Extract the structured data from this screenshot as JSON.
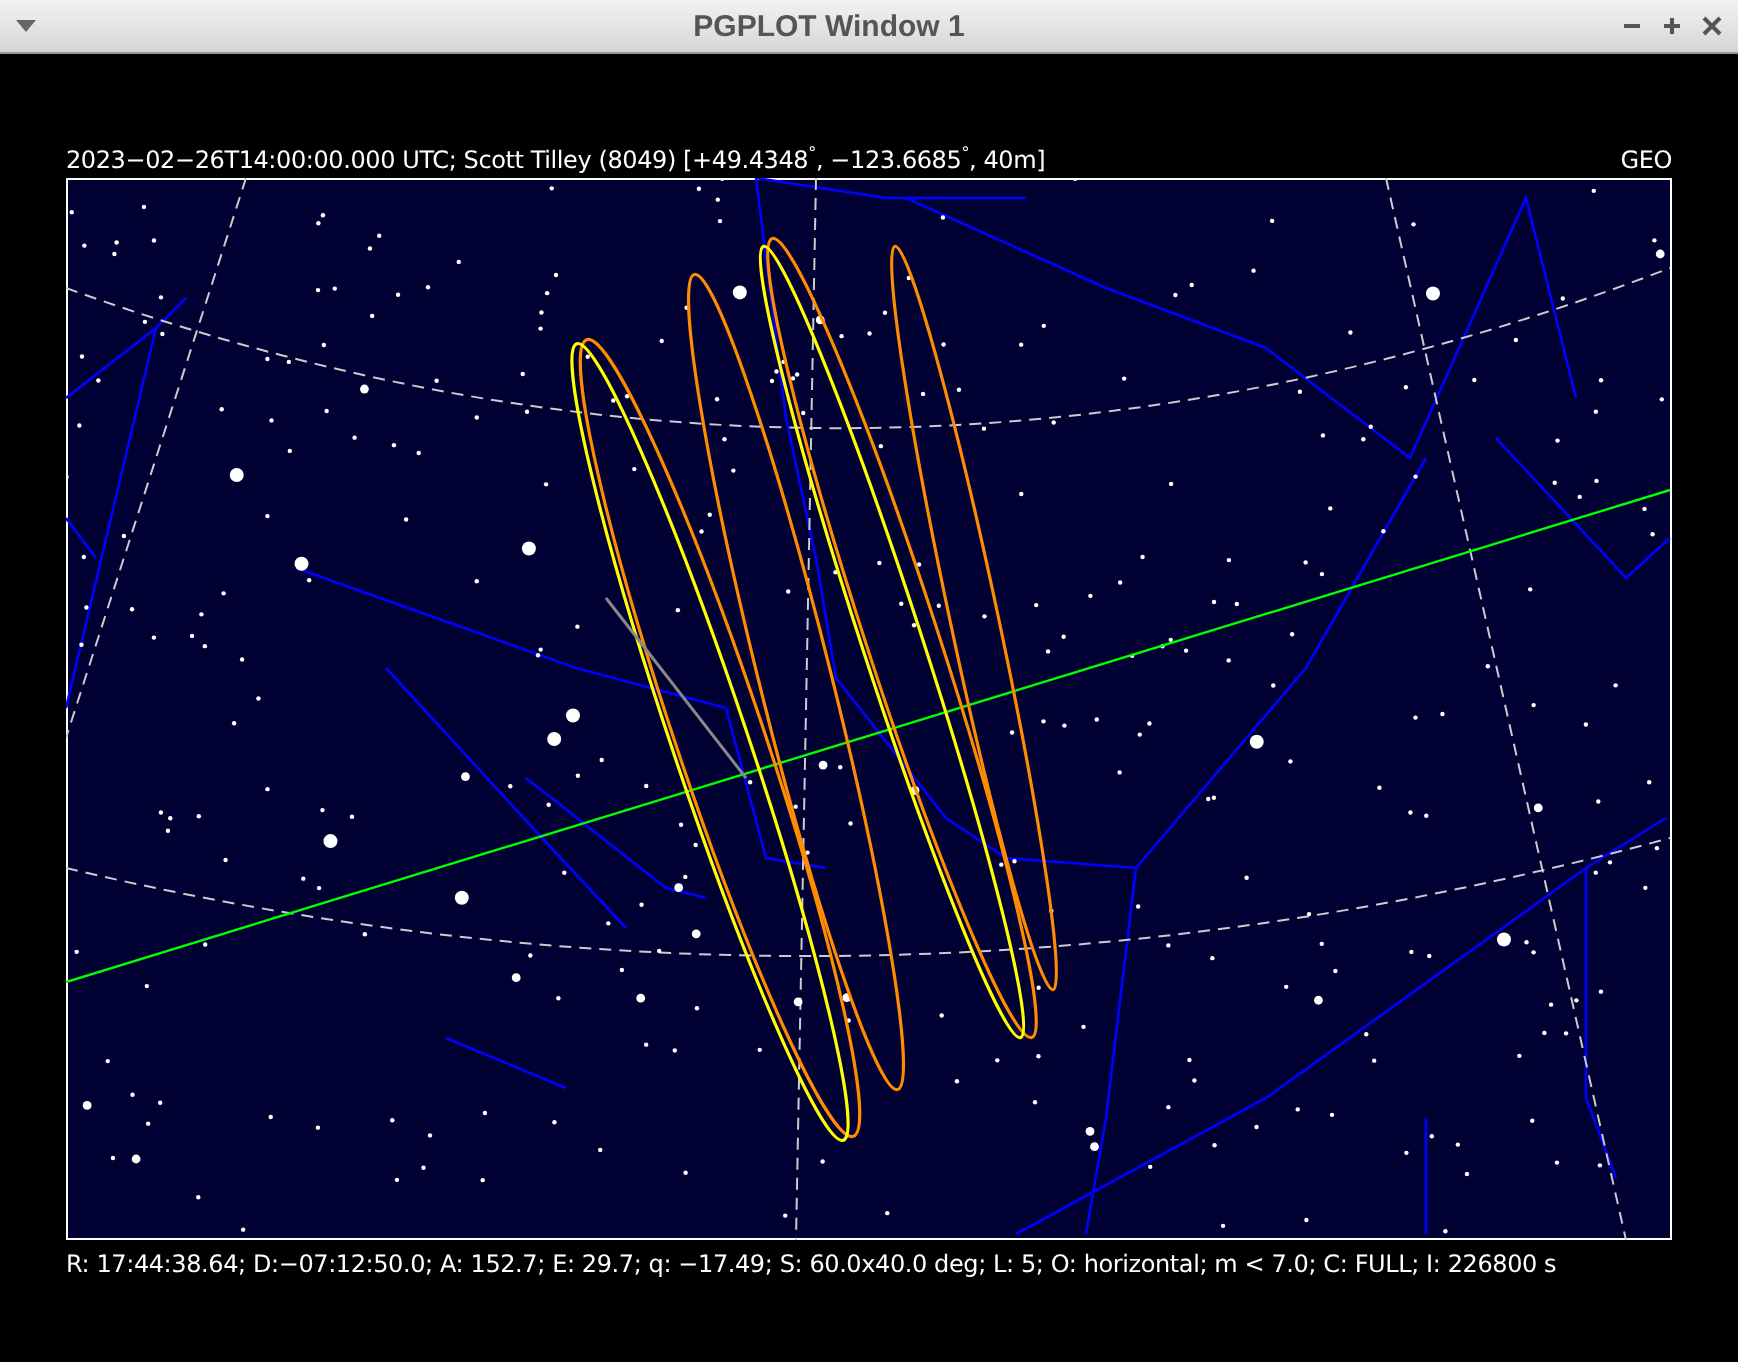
{
  "window": {
    "title": "PGPLOT Window 1"
  },
  "header": {
    "left": "2023−02−26T14:00:00.000 UTC; Scott Tilley (8049) [+49.4348$^{°}$, −123.6685$^{°}$, 40m]",
    "right": "GEO"
  },
  "footer": "R: 17:44:38.64; D:−07:12:50.0; A: 152.7; E: 29.7; q: −17.49; S: 60.0x40.0 deg; L: 5; O: horizontal; m < 7.0; C: FULL; I: 226800 s"
}
